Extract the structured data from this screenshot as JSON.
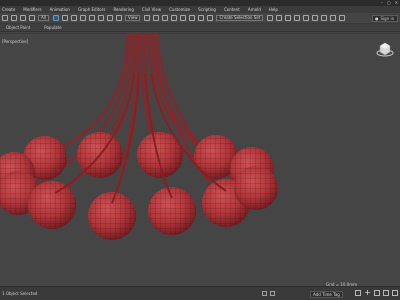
{
  "menubar": {
    "items": [
      "Create",
      "Modifiers",
      "Animation",
      "Graph Editors",
      "Rendering",
      "Civil View",
      "Customize",
      "Scripting",
      "Content",
      "Arnold",
      "Help"
    ],
    "signin": "Sign in"
  },
  "toolbar": {
    "filter_label": "All",
    "view_label": "View",
    "selection_set_label": "Create Selection Set"
  },
  "ribbon": {
    "items": [
      "Object Paint",
      "Populate"
    ]
  },
  "viewport": {
    "label": "[Perspective]"
  },
  "status": {
    "left_text": "1 Object Selected",
    "coord_text": "Grid = 10.0mm",
    "add_time_tag": "Add Time Tag"
  },
  "colors": {
    "sphere": "#b8393c",
    "sphere_dark": "#7a1e22",
    "background": "#454545"
  }
}
